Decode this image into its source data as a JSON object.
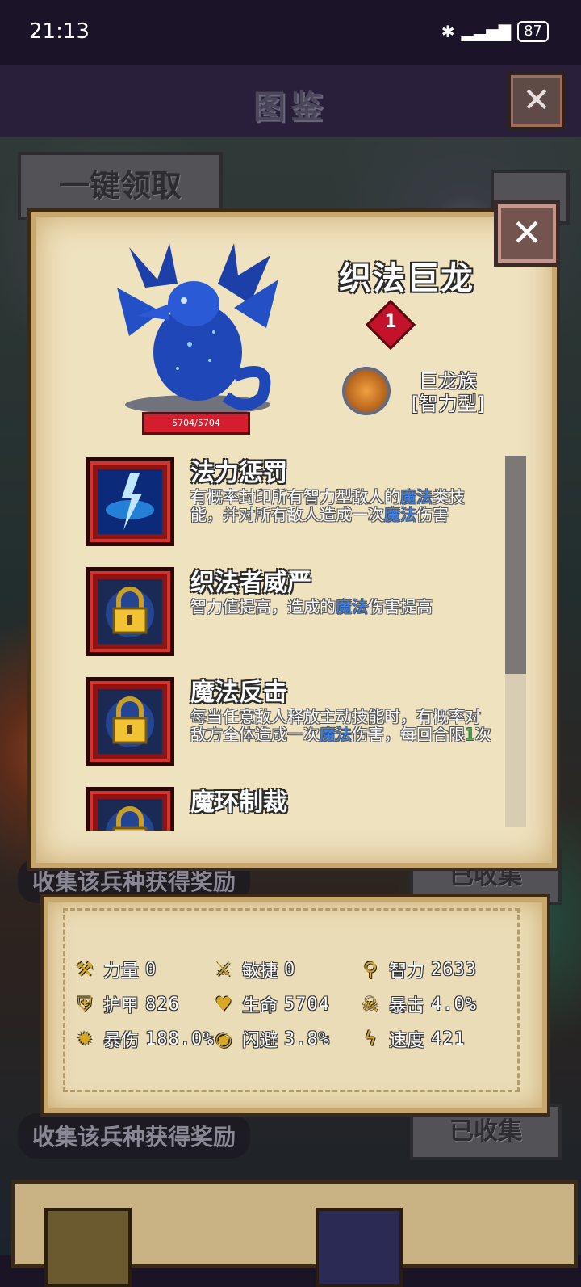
{
  "status_bar": {
    "time": "21:13",
    "bluetooth_icon": "bluetooth-icon",
    "signal_icon": "signal-icon",
    "battery": "87"
  },
  "header": {
    "title": "图鉴"
  },
  "collect_all_button": "一键领取",
  "unit": {
    "name": "织法巨龙",
    "rank": "1",
    "race": "巨龙族",
    "type": "[智力型]",
    "hp": "5704/5704"
  },
  "skills": [
    {
      "name": "法力惩罚",
      "icon": "lightning-icon",
      "desc": [
        {
          "t": "有概率封印所有智力型敌人的"
        },
        {
          "t": "魔法",
          "c": "kw"
        },
        {
          "t": "类技能，并对所有敌人造成一次"
        },
        {
          "t": "魔法",
          "c": "kw"
        },
        {
          "t": "伤害"
        }
      ]
    },
    {
      "name": "织法者威严",
      "icon": "lock-icon",
      "desc": [
        {
          "t": "智力值提高，造成的"
        },
        {
          "t": "魔法",
          "c": "kw"
        },
        {
          "t": "伤害提高"
        }
      ]
    },
    {
      "name": "魔法反击",
      "icon": "lock-icon",
      "desc": [
        {
          "t": "每当任意敌人释放主动技能时，有概率对敌方全体造成一次"
        },
        {
          "t": "魔法",
          "c": "kw"
        },
        {
          "t": "伤害，每回合限"
        },
        {
          "t": "1",
          "c": "kw-green"
        },
        {
          "t": "次"
        }
      ]
    },
    {
      "name": "魔环制裁",
      "icon": "lock-icon",
      "desc": []
    }
  ],
  "rewards": [
    {
      "label": "收集该兵种获得奖励",
      "status": "已收集"
    },
    {
      "label": "收集该兵种获得奖励",
      "status": "已收集"
    }
  ],
  "stats": [
    {
      "icon": "axe-icon",
      "label": "力量",
      "value": "0"
    },
    {
      "icon": "sword-icon",
      "label": "敏捷",
      "value": "0"
    },
    {
      "icon": "staff-icon",
      "label": "智力",
      "value": "2633"
    },
    {
      "icon": "shield-icon",
      "label": "护甲",
      "value": "826"
    },
    {
      "icon": "heart-icon",
      "label": "生命",
      "value": "5704"
    },
    {
      "icon": "skull-icon",
      "label": "暴击",
      "value": "4.0%"
    },
    {
      "icon": "burst-icon",
      "label": "暴伤",
      "value": "188.0%"
    },
    {
      "icon": "eye-icon",
      "label": "闪避",
      "value": "3.8%"
    },
    {
      "icon": "lightning-icon",
      "label": "速度",
      "value": "421"
    }
  ],
  "colors": {
    "keyword_blue": "#3a86ff",
    "keyword_green": "#3cc44a",
    "parchment": "#efe2bf"
  }
}
